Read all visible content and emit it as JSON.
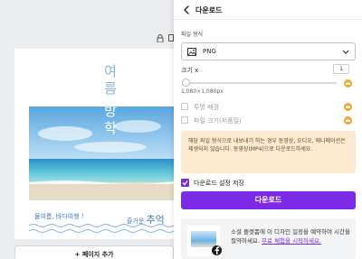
{
  "editor": {
    "vertical_title_blue": [
      "여",
      "름"
    ],
    "vertical_title_white": [
      "방",
      "학"
    ],
    "caption_left": "물여름, 바다여행 !",
    "caption_right_small": "즐거운",
    "caption_right_big": "추억",
    "add_page_label": "+ 페이지 추가"
  },
  "panel": {
    "title": "다운로드",
    "file_type_label": "파일 형식",
    "file_type_value": "PNG",
    "size_label": "크기 x",
    "size_value": "1",
    "size_fraction": 0.02,
    "dimensions": "1,080×1,080px",
    "option_transparent": "투명 배경",
    "option_compress": "파일 크기(저품질)",
    "notice": "해당 파일 형식으로 내보내기 하는 경우 동영상, 오디오, 애니메이션은 제생되지 않습니다. 동영상(MP4)으로 다운로드하세요.",
    "save_settings_label": "다운로드 설정 저장",
    "download_button": "다운로드",
    "promo_text": "소셜 플랫폼에 이 디자인 일정을 예약하여 시간을 절약하세요.",
    "promo_link": "무료 체험을 시작하세요."
  },
  "colors": {
    "accent": "#7d2ae8",
    "crown": "#f4a524",
    "notice_bg": "#fde9cf"
  }
}
